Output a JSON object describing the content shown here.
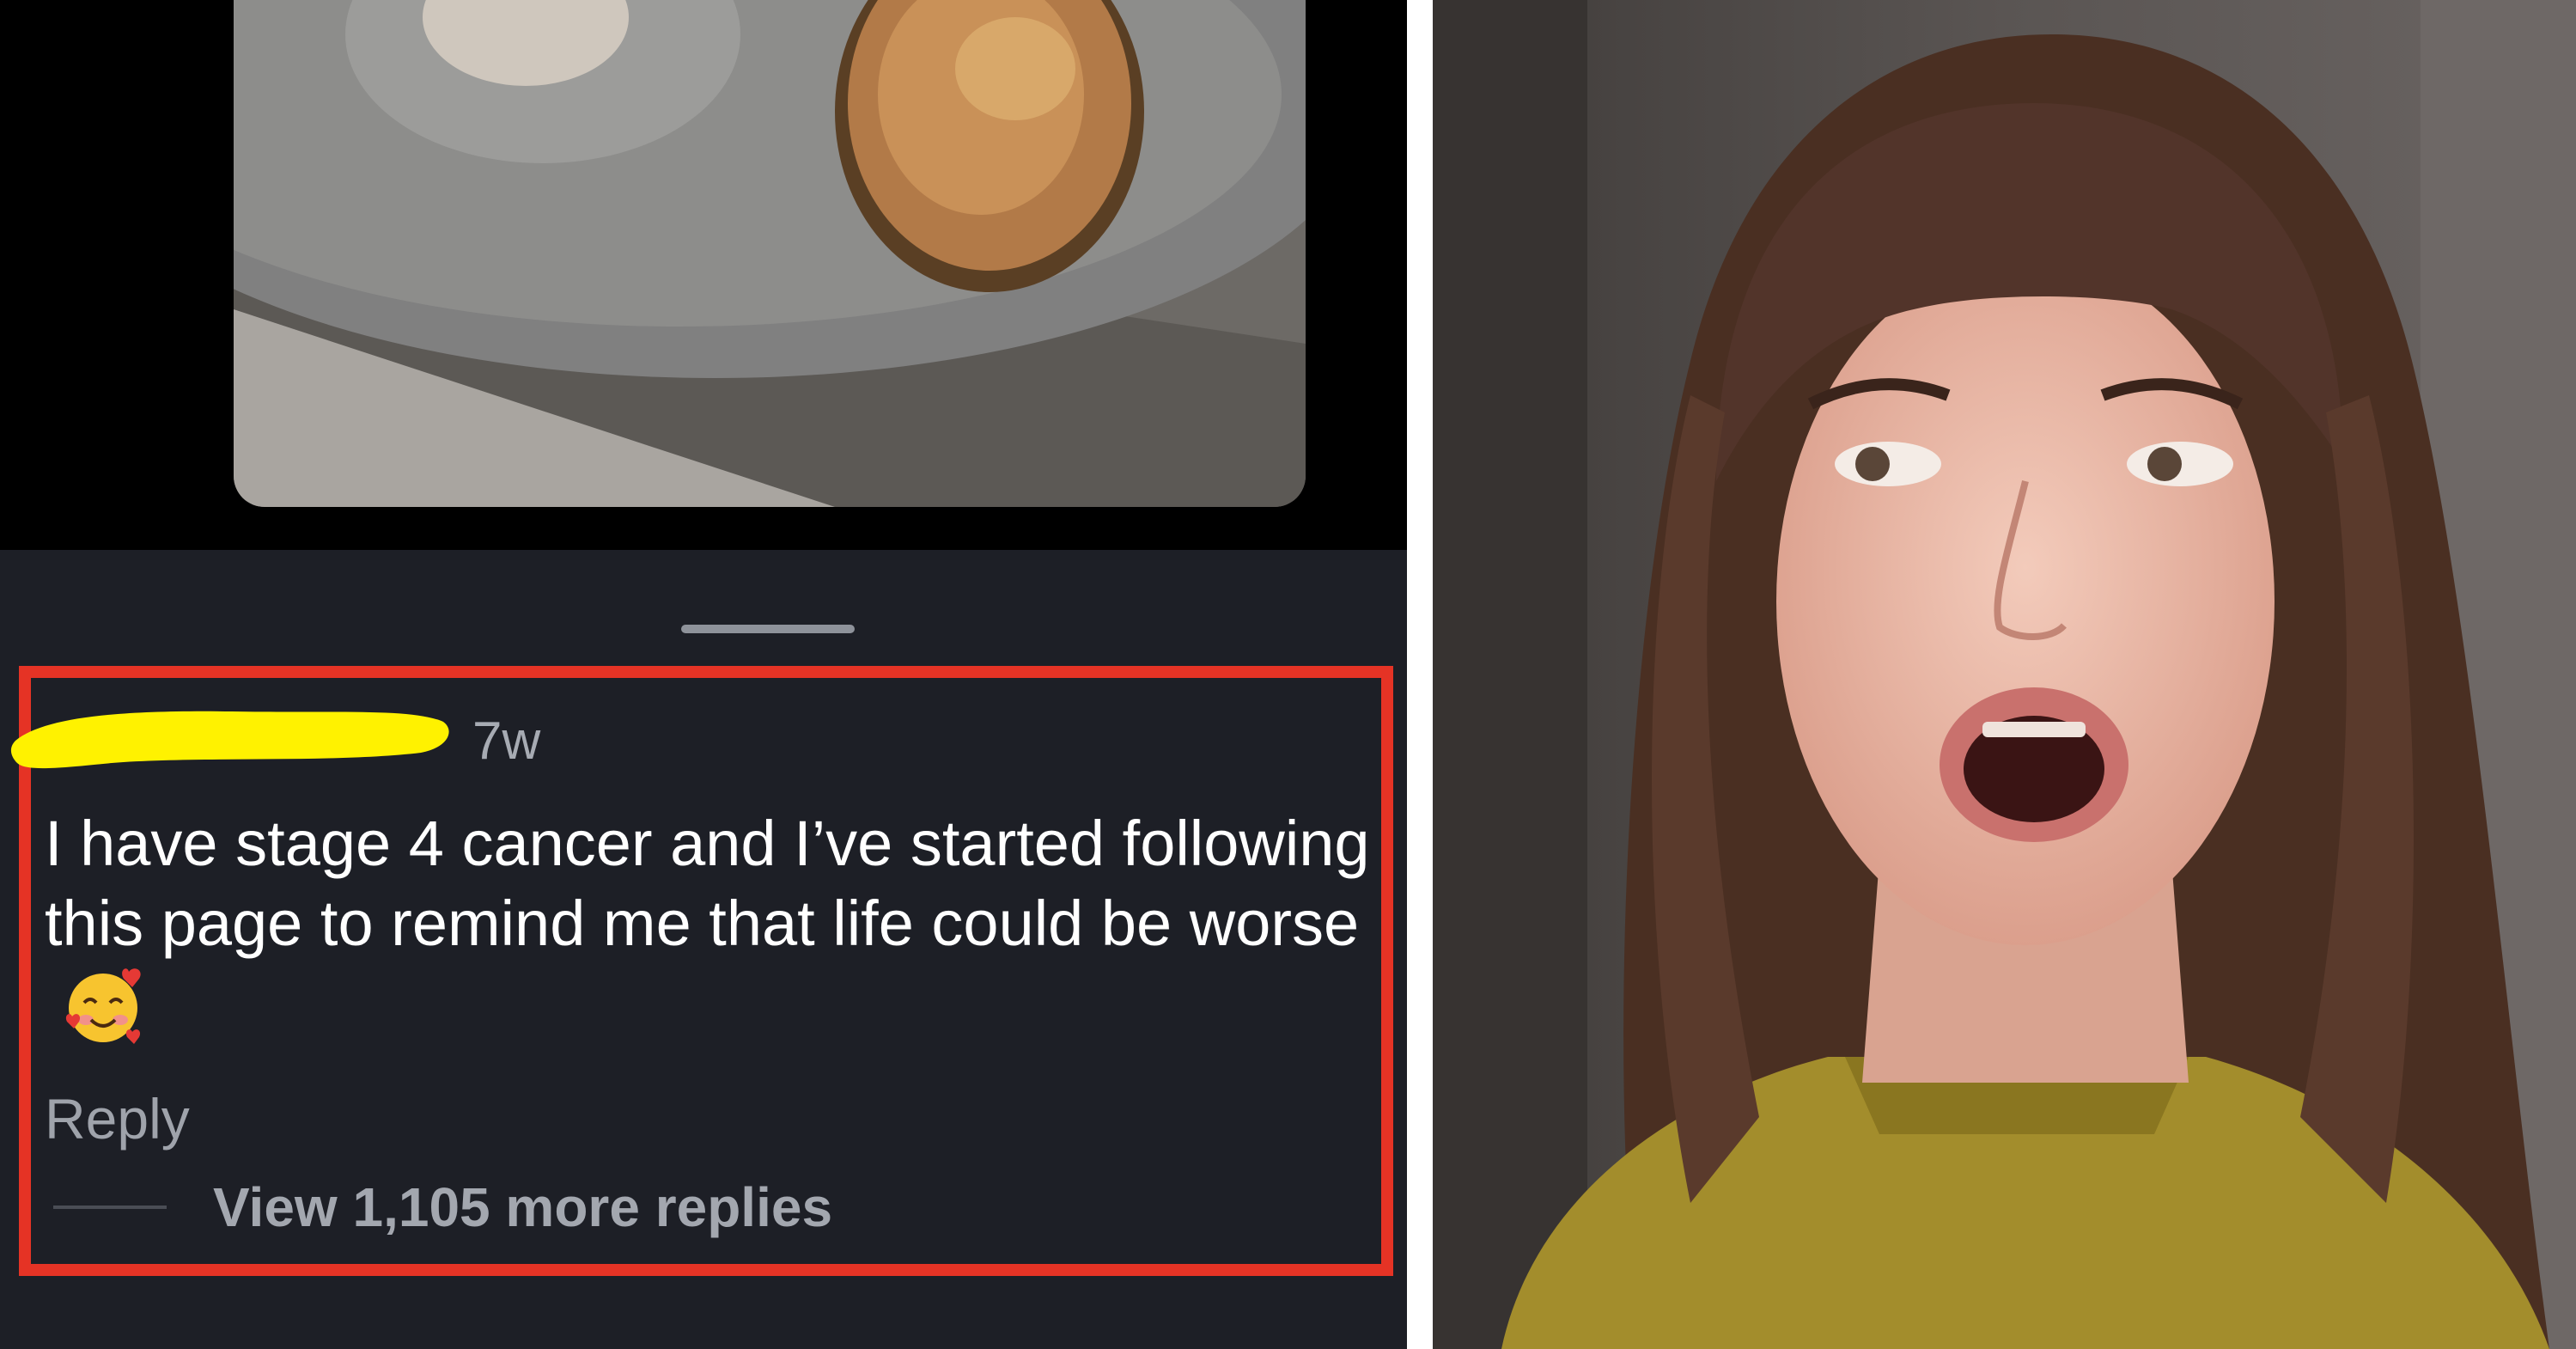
{
  "comment": {
    "timestamp": "7w",
    "text": "I have stage 4 cancer and I’ve started following this page to remind me that life could be worse",
    "emoji": "smiling-face-with-hearts",
    "reply_label": "Reply",
    "view_replies_label": "View 1,105 more replies"
  },
  "colors": {
    "highlight_border": "#e53325",
    "redaction": "#fff200",
    "sheet_background": "#1d1f26"
  }
}
